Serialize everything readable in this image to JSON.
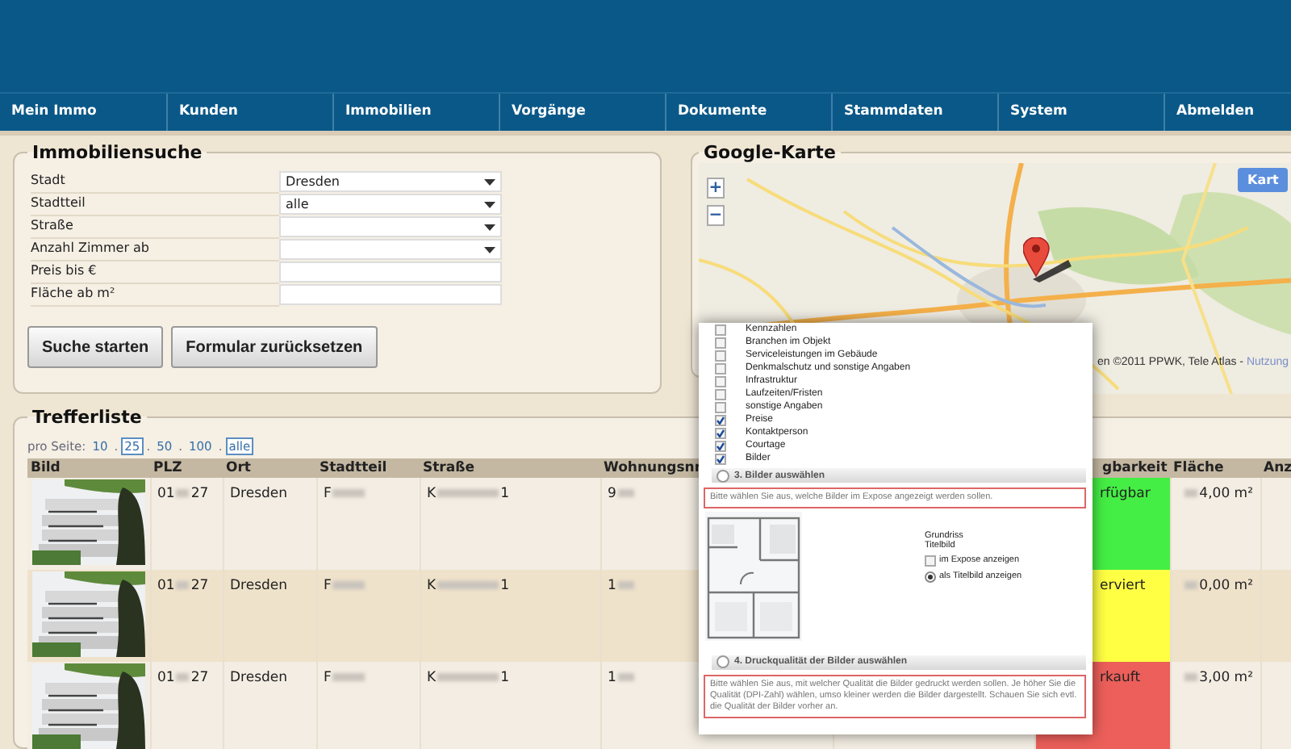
{
  "nav": [
    {
      "label": "Mein Immo"
    },
    {
      "label": "Kunden"
    },
    {
      "label": "Immobilien"
    },
    {
      "label": "Vorgänge"
    },
    {
      "label": "Dokumente"
    },
    {
      "label": "Stammdaten"
    },
    {
      "label": "System"
    },
    {
      "label": "Abmelden"
    }
  ],
  "search": {
    "title": "Immobiliensuche",
    "fields": [
      {
        "label": "Stadt",
        "kind": "select",
        "value": "Dresden"
      },
      {
        "label": "Stadtteil",
        "kind": "select",
        "value": "alle"
      },
      {
        "label": "Straße",
        "kind": "select"
      },
      {
        "label": "Anzahl Zimmer ab",
        "kind": "select"
      },
      {
        "label": "Preis bis €",
        "kind": "text"
      },
      {
        "label": "Fläche ab m²",
        "kind": "text"
      }
    ],
    "buttons": [
      "Suche starten",
      "Formular zurücksetzen"
    ]
  },
  "map": {
    "title": "Google-Karte",
    "zoom_in": "+",
    "zoom_out": "−",
    "type_button": "Kart",
    "attribution": "en ©2011 PPWK, Tele Atlas -",
    "attribution_link": "Nutzung"
  },
  "results": {
    "title": "Trefferliste",
    "page_size_label": "pro Seite:",
    "separator": ".",
    "page_sizes": [
      {
        "label": "10",
        "selected": false
      },
      {
        "label": "25",
        "selected": true
      },
      {
        "label": "50",
        "selected": false
      },
      {
        "label": "100",
        "selected": false
      },
      {
        "label": "alle",
        "selected": true
      }
    ],
    "columns": [
      "Bild",
      "PLZ",
      "Ort",
      "Stadtteil",
      "Straße",
      "Wohnungsnr",
      "gbarkeit",
      "Fläche",
      "Anz"
    ],
    "rows": [
      {
        "plz": {
          "before": "01",
          "after": "27"
        },
        "ort": "Dresden",
        "stadtteil": {
          "before": "F"
        },
        "strasse": {
          "before": "K",
          "after": "1"
        },
        "wohnungsnr": {
          "before": "9"
        },
        "status": "rfügbar",
        "color": "#44ee44",
        "flaeche": {
          "after": "4,00 m²"
        }
      },
      {
        "plz": {
          "before": "01",
          "after": "27"
        },
        "ort": "Dresden",
        "stadtteil": {
          "before": "F"
        },
        "strasse": {
          "before": "K",
          "after": "1"
        },
        "wohnungsnr": {
          "before": "1"
        },
        "status": "erviert",
        "color": "#ffff44",
        "flaeche": {
          "after": "0,00 m²"
        }
      },
      {
        "plz": {
          "before": "01",
          "after": "27"
        },
        "ort": "Dresden",
        "stadtteil": {
          "before": "F"
        },
        "strasse": {
          "before": "K",
          "after": "1"
        },
        "wohnungsnr": {
          "before": "1"
        },
        "status": "rkauft",
        "color": "#ec5f5a",
        "flaeche": {
          "after": "3,00 m²"
        }
      }
    ]
  },
  "dialog": {
    "options": [
      {
        "label": "Kennzahlen",
        "checked": false
      },
      {
        "label": "Branchen im Objekt",
        "checked": false
      },
      {
        "label": "Serviceleistungen im Gebäude",
        "checked": false
      },
      {
        "label": "Denkmalschutz und sonstige Angaben",
        "checked": false
      },
      {
        "label": "Infrastruktur",
        "checked": false
      },
      {
        "label": "Laufzeiten/Fristen",
        "checked": false
      },
      {
        "label": "sonstige Angaben",
        "checked": false
      },
      {
        "label": "Preise",
        "checked": true
      },
      {
        "label": "Kontaktperson",
        "checked": true
      },
      {
        "label": "Courtage",
        "checked": true
      },
      {
        "label": "Bilder",
        "checked": true
      }
    ],
    "step3": {
      "title": "3. Bilder auswählen",
      "hint": "Bitte wählen Sie aus, welche Bilder im Expose angezeigt werden sollen.",
      "caption": [
        "Grundriss",
        "Titelbild"
      ],
      "show_in_expose": {
        "label": "im Expose anzeigen",
        "checked": false
      },
      "as_title": {
        "label": "als Titelbild anzeigen",
        "selected": true
      }
    },
    "step4": {
      "title": "4. Druckqualität der Bilder auswählen",
      "hint": "Bitte wählen Sie aus, mit welcher Qualität die Bilder gedruckt werden sollen. Je höher Sie die Qualität (DPI-Zahl) wählen, umso kleiner werden die Bilder dargestellt. Schauen Sie sich evtl. die Qualität der Bilder vorher an."
    }
  }
}
